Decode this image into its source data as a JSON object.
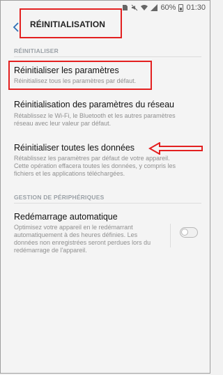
{
  "status_bar": {
    "battery": "60%",
    "time": "01:30"
  },
  "header": {
    "title": "RÉINITIALISATION"
  },
  "sections": {
    "reset_header": "RÉINITIALISER",
    "device_header": "GESTION DE PÉRIPHÉRIQUES"
  },
  "items": {
    "reset_settings": {
      "title": "Réinitialiser les paramètres",
      "desc": "Réinitialisez tous les paramètres par défaut."
    },
    "reset_network": {
      "title": "Réinitialisation des paramètres du réseau",
      "desc_line1": "Rétablissez le Wi-Fi, le Bluetooth et les autres paramètres",
      "desc_line2": "réseau avec leur valeur par défaut."
    },
    "reset_all": {
      "title": "Réinitialiser toutes les données",
      "desc_line1": "Rétablissez les paramètres par défaut de votre appareil.",
      "desc_line2": "Cette opération effacera toutes les données, y compris les",
      "desc_line3": "fichiers et les applications téléchargées."
    },
    "auto_restart": {
      "title": "Redémarrage automatique",
      "desc_line1": "Optimisez votre appareil en le redémarrant",
      "desc_line2": "automatiquement à des heures définies. Les",
      "desc_line3": "données non enregistrées seront perdues lors du",
      "desc_line4": "redémarrage de l'appareil.",
      "enabled": false
    }
  },
  "colors": {
    "annotation_red": "#e32020",
    "background": "#f4f4f4"
  }
}
